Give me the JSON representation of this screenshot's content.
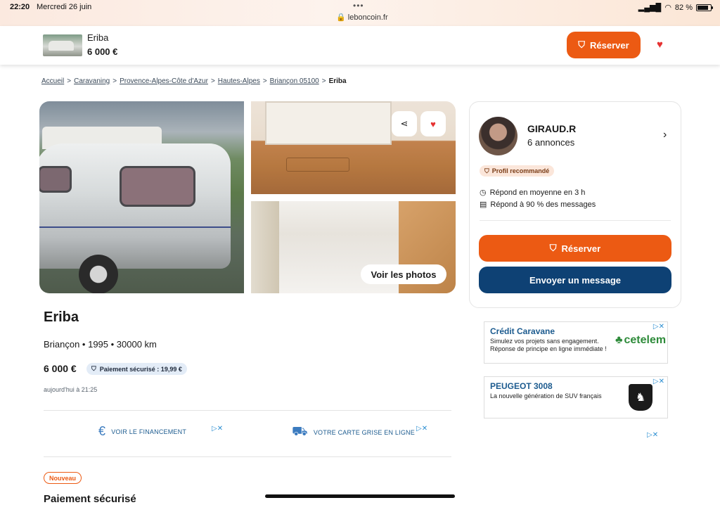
{
  "status_bar": {
    "time": "22:20",
    "date": "Mercredi 26 juin",
    "url": "leboncoin.fr",
    "battery": "82 %"
  },
  "header": {
    "title": "Eriba",
    "price": "6 000 €",
    "reserve_label": "Réserver"
  },
  "breadcrumb": {
    "items": [
      "Accueil",
      "Caravaning",
      "Provence-Alpes-Côte d'Azur",
      "Hautes-Alpes",
      "Briançon 05100"
    ],
    "separator": ">",
    "current": "Eriba"
  },
  "gallery": {
    "view_photos_label": "Voir les photos"
  },
  "listing": {
    "title": "Eriba",
    "meta": "Briançon • 1995 • 30000 km",
    "price": "6 000 €",
    "payment_badge": "Paiement sécurisé : 19,99 €",
    "date": "aujourd'hui à 21:25",
    "promo_financing": "VOIR LE FINANCEMENT",
    "promo_registration": "VOTRE CARTE GRISE EN LIGNE",
    "new_badge": "Nouveau",
    "section_title": "Paiement sécurisé"
  },
  "seller": {
    "name": "GIRAUD.R",
    "ads_count": "6 annonces",
    "badge": "Profil recommandé",
    "response_time": "Répond en moyenne en 3 h",
    "response_rate": "Répond à 90 % des messages",
    "reserve_label": "Réserver",
    "message_label": "Envoyer un message"
  },
  "ads": [
    {
      "title": "Crédit Caravane",
      "text": "Simulez vos projets sans engagement. Réponse de principe en ligne immédiate !",
      "brand": "cetelem"
    },
    {
      "title": "PEUGEOT 3008",
      "text": "La nouvelle génération de SUV français"
    }
  ],
  "colors": {
    "accent": "#ec5a13",
    "primary_dark": "#0e4174",
    "link": "#1c5b8f"
  }
}
